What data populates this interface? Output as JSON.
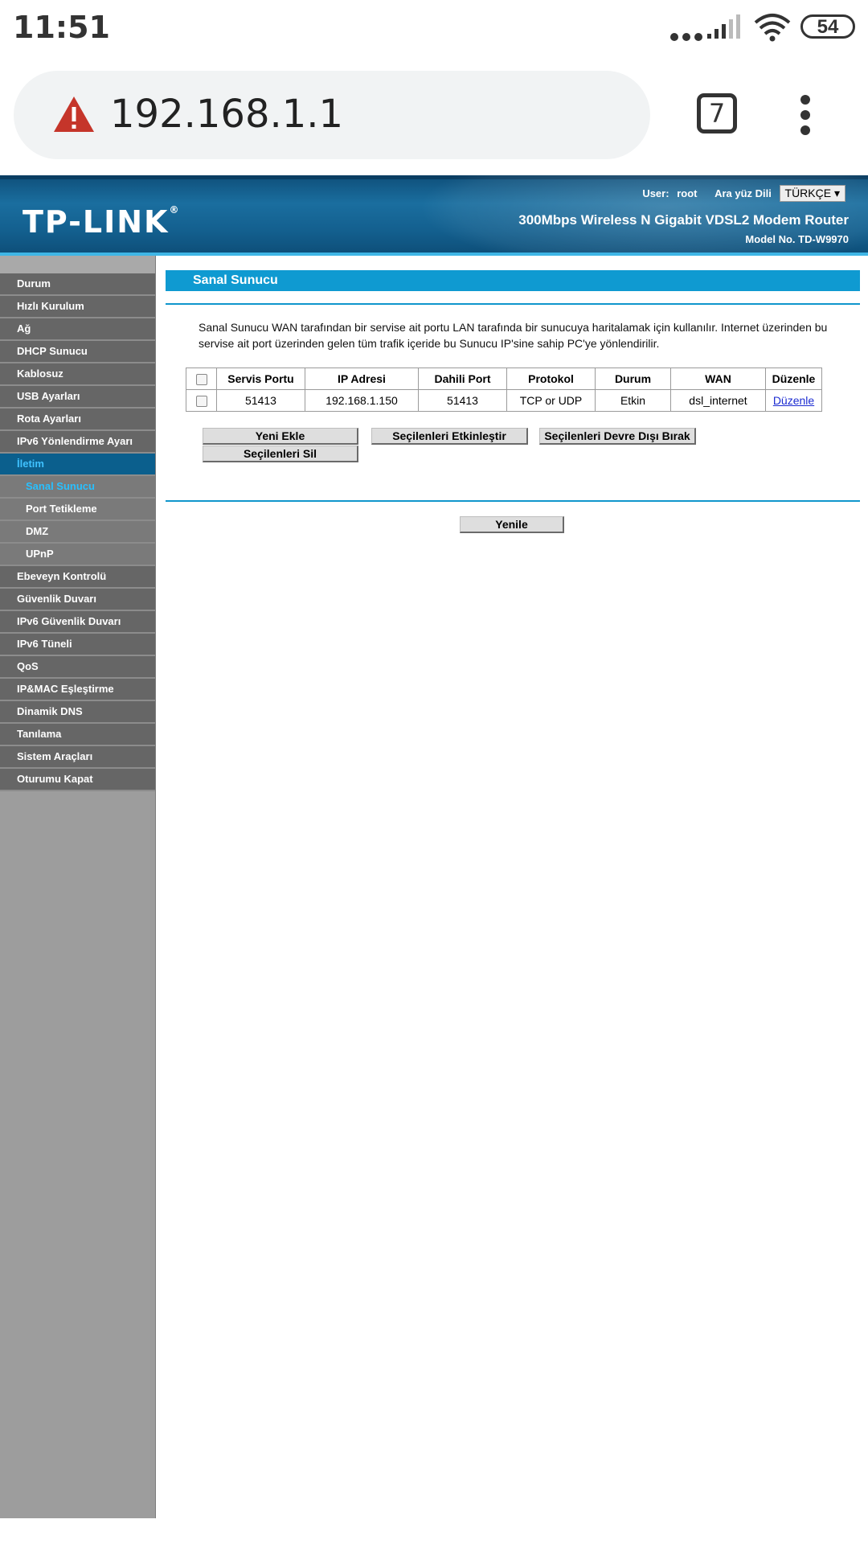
{
  "status_bar": {
    "time": "11:51",
    "battery": "54"
  },
  "browser": {
    "url": "192.168.1.1",
    "tab_count": "7"
  },
  "header": {
    "logo": "TP-LINK",
    "user_label": "User:",
    "user_value": "root",
    "lang_label": "Ara yüz Dili",
    "lang_value": "TÜRKÇE ▾",
    "product": "300Mbps Wireless N Gigabit VDSL2 Modem Router",
    "model": "Model No. TD-W9970"
  },
  "sidebar": {
    "items": [
      {
        "label": "Durum"
      },
      {
        "label": "Hızlı Kurulum"
      },
      {
        "label": "Ağ"
      },
      {
        "label": "DHCP Sunucu"
      },
      {
        "label": "Kablosuz"
      },
      {
        "label": "USB Ayarları"
      },
      {
        "label": "Rota Ayarları"
      },
      {
        "label": "IPv6 Yönlendirme Ayarı"
      },
      {
        "label": "İletim"
      },
      {
        "label": "Sanal Sunucu"
      },
      {
        "label": "Port Tetikleme"
      },
      {
        "label": "DMZ"
      },
      {
        "label": "UPnP"
      },
      {
        "label": "Ebeveyn Kontrolü"
      },
      {
        "label": "Güvenlik Duvarı"
      },
      {
        "label": "IPv6 Güvenlik Duvarı"
      },
      {
        "label": "IPv6 Tüneli"
      },
      {
        "label": "QoS"
      },
      {
        "label": "IP&MAC Eşleştirme"
      },
      {
        "label": "Dinamik DNS"
      },
      {
        "label": "Tanılama"
      },
      {
        "label": "Sistem Araçları"
      },
      {
        "label": "Oturumu Kapat"
      }
    ]
  },
  "main": {
    "title": "Sanal Sunucu",
    "description": "Sanal Sunucu WAN tarafından bir servise ait portu LAN tarafında bir sunucuya haritalamak için kullanılır. Internet üzerinden bu servise ait port üzerinden gelen tüm trafik içeride bu Sunucu IP'sine sahip PC'ye yönlendirilir.",
    "table": {
      "headers": [
        "Servis Portu",
        "IP Adresi",
        "Dahili Port",
        "Protokol",
        "Durum",
        "WAN",
        "Düzenle"
      ],
      "rows": [
        {
          "service_port": "51413",
          "ip": "192.168.1.150",
          "internal_port": "51413",
          "protocol": "TCP or UDP",
          "status": "Etkin",
          "wan": "dsl_internet",
          "edit": "Düzenle"
        }
      ]
    },
    "buttons": {
      "add": "Yeni Ekle",
      "enable": "Seçilenleri Etkinleştir",
      "disable": "Seçilenleri Devre Dışı Bırak",
      "delete": "Seçilenleri Sil",
      "refresh": "Yenile"
    }
  }
}
